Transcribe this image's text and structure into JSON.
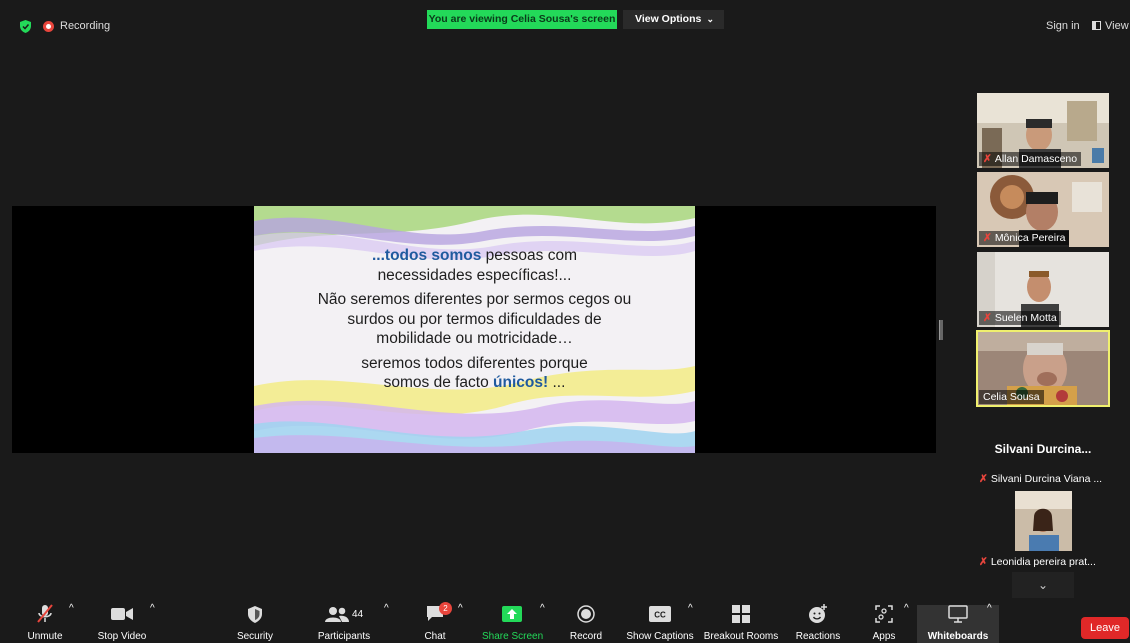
{
  "topbar": {
    "recording_label": "Recording",
    "viewing_banner": "You are viewing Celia Sousa's screen",
    "view_options_label": "View Options",
    "sign_in_label": "Sign in",
    "view_label": "View",
    "accent_green": "#23d959"
  },
  "slide": {
    "line1_highlight": "...todos somos",
    "line1_rest": " pessoas com",
    "line2": "necessidades específicas!...",
    "para2": "Não seremos diferentes por sermos cegos ou surdos ou por termos dificuldades de mobilidade ou motricidade…",
    "para3_start": "seremos todos diferentes porque somos de facto ",
    "para3_highlight": "únicos!",
    "para3_end": " ..."
  },
  "participants": [
    {
      "name": "Allan Damasceno"
    },
    {
      "name": "Mônica Pereira"
    },
    {
      "name": "Suelen Motta"
    },
    {
      "name": "Celia Sousa"
    },
    {
      "name": "Silvani Durcina Viana ...",
      "display": "Silvani  Durcina..."
    },
    {
      "name": "Leonidia pereira prat..."
    }
  ],
  "toolbar": {
    "unmute": "Unmute",
    "stop_video": "Stop Video",
    "security": "Security",
    "participants": "Participants",
    "participants_count": "44",
    "chat": "Chat",
    "chat_badge": "2",
    "share_screen": "Share Screen",
    "record": "Record",
    "show_captions": "Show Captions",
    "breakout_rooms": "Breakout Rooms",
    "reactions": "Reactions",
    "apps": "Apps",
    "whiteboards": "Whiteboards",
    "leave": "Leave",
    "leave_color": "#e02828"
  }
}
